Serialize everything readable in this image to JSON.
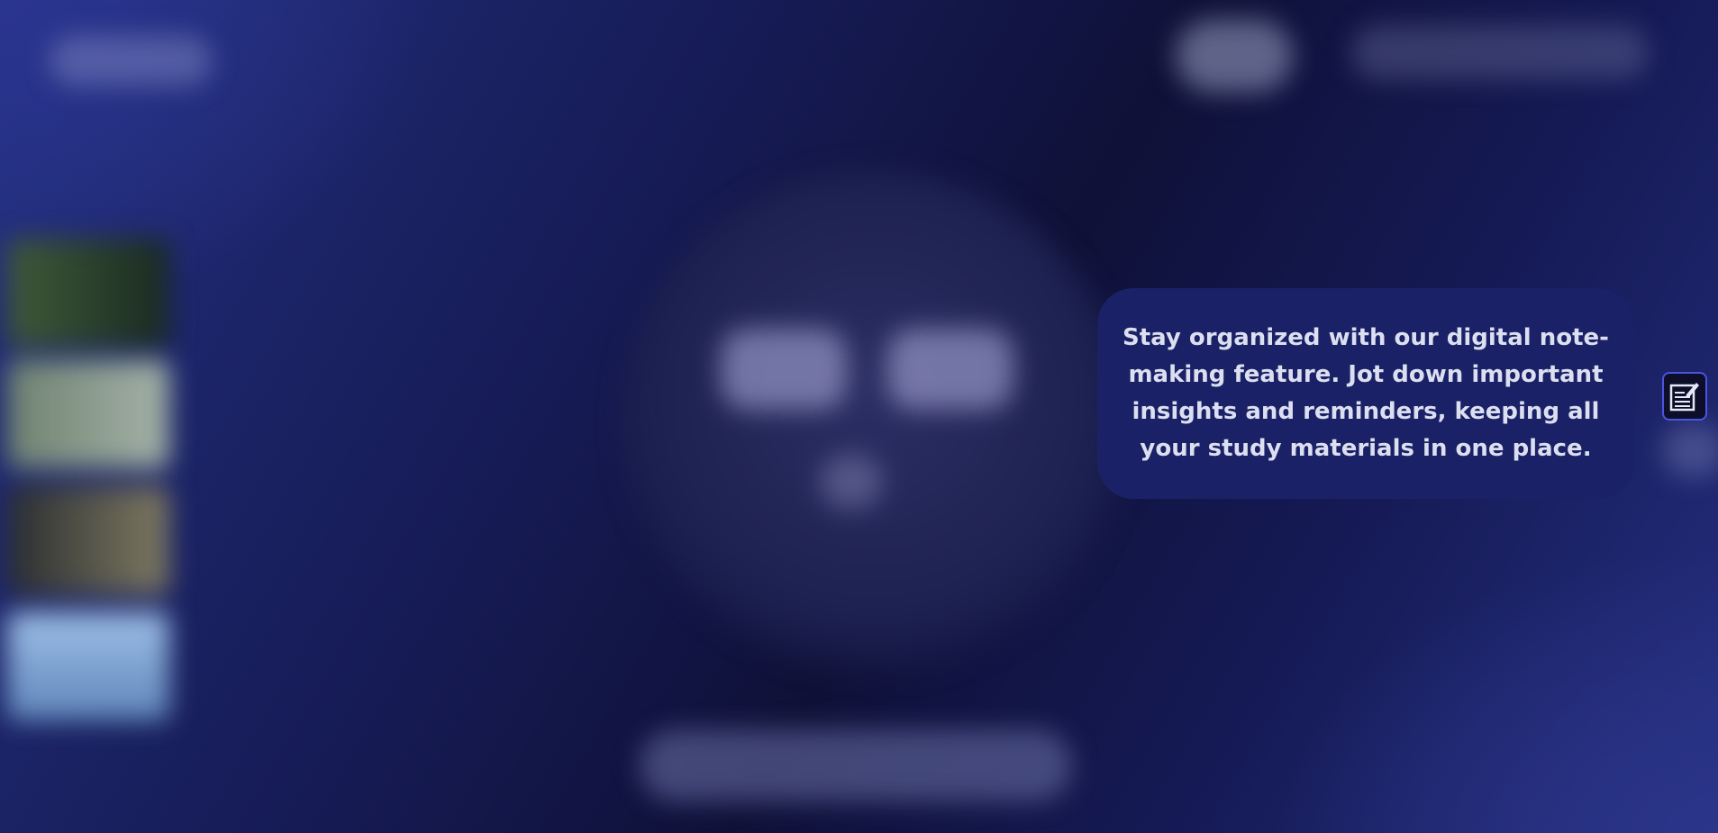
{
  "background": {
    "accent": "#2a3590",
    "dark": "#0f1138"
  },
  "tooltip": {
    "text": "Stay organized with our digital note-making feature. Jot down important insights and reminders, keeping all your study materials in one place.",
    "background_color": "#1a2166",
    "text_color": "#dcdff0"
  },
  "notes_button": {
    "icon": "note-edit-icon",
    "border_color": "#4a55e0"
  }
}
